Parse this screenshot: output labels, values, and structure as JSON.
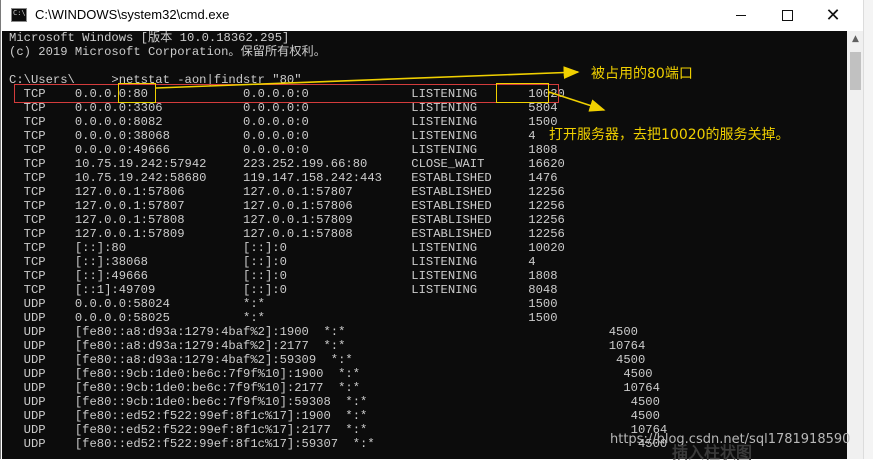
{
  "window": {
    "title": "C:\\WINDOWS\\system32\\cmd.exe",
    "app_icon": "cmd-console-icon",
    "controls": {
      "minimize": "minimize-icon",
      "maximize": "maximize-icon",
      "close": "close-icon"
    }
  },
  "console": {
    "lines": [
      "Microsoft Windows [版本 10.0.18362.295]",
      "(c) 2019 Microsoft Corporation。保留所有权利。",
      "",
      "C:\\Users\\     >netstat -aon|findstr \"80\"",
      "  TCP    0.0.0.0:80             0.0.0.0:0              LISTENING       10020",
      "  TCP    0.0.0.0:3306           0.0.0.0:0              LISTENING       5804",
      "  TCP    0.0.0.0:8082           0.0.0.0:0              LISTENING       1500",
      "  TCP    0.0.0.0:38068          0.0.0.0:0              LISTENING       4",
      "  TCP    0.0.0.0:49666          0.0.0.0:0              LISTENING       1808",
      "  TCP    10.75.19.242:57942     223.252.199.66:80      CLOSE_WAIT      16620",
      "  TCP    10.75.19.242:58680     119.147.158.242:443    ESTABLISHED     1476",
      "  TCP    127.0.0.1:57806        127.0.0.1:57807        ESTABLISHED     12256",
      "  TCP    127.0.0.1:57807        127.0.0.1:57806        ESTABLISHED     12256",
      "  TCP    127.0.0.1:57808        127.0.0.1:57809        ESTABLISHED     12256",
      "  TCP    127.0.0.1:57809        127.0.0.1:57808        ESTABLISHED     12256",
      "  TCP    [::]:80                [::]:0                 LISTENING       10020",
      "  TCP    [::]:38068             [::]:0                 LISTENING       4",
      "  TCP    [::]:49666             [::]:0                 LISTENING       1808",
      "  TCP    [::1]:49709            [::]:0                 LISTENING       8048",
      "  UDP    0.0.0.0:58024          *:*                                    1500",
      "  UDP    0.0.0.0:58025          *:*                                    1500",
      "  UDP    [fe80::a8:d93a:1279:4baf%2]:1900  *:*                                    4500",
      "  UDP    [fe80::a8:d93a:1279:4baf%2]:2177  *:*                                    10764",
      "  UDP    [fe80::a8:d93a:1279:4baf%2]:59309  *:*                                    4500",
      "  UDP    [fe80::9cb:1de0:be6c:7f9f%10]:1900  *:*                                    4500",
      "  UDP    [fe80::9cb:1de0:be6c:7f9f%10]:2177  *:*                                    10764",
      "  UDP    [fe80::9cb:1de0:be6c:7f9f%10]:59308  *:*                                    4500",
      "  UDP    [fe80::ed52:f522:99ef:8f1c%17]:1900  *:*                                    4500",
      "  UDP    [fe80::ed52:f522:99ef:8f1c%17]:2177  *:*                                    10764",
      "  UDP    [fe80::ed52:f522:99ef:8f1c%17]:59307  *:*                                    4500"
    ]
  },
  "annotations": {
    "port_label": "被占用的80端口",
    "service_label": "打开服务器，去把10020的服务关掉。",
    "color": "#f0d000",
    "row_box_color": "#d43c3c"
  },
  "watermark": "https://blog.csdn.net/sql1781918590",
  "bottom_fragment": "插入柱状图"
}
